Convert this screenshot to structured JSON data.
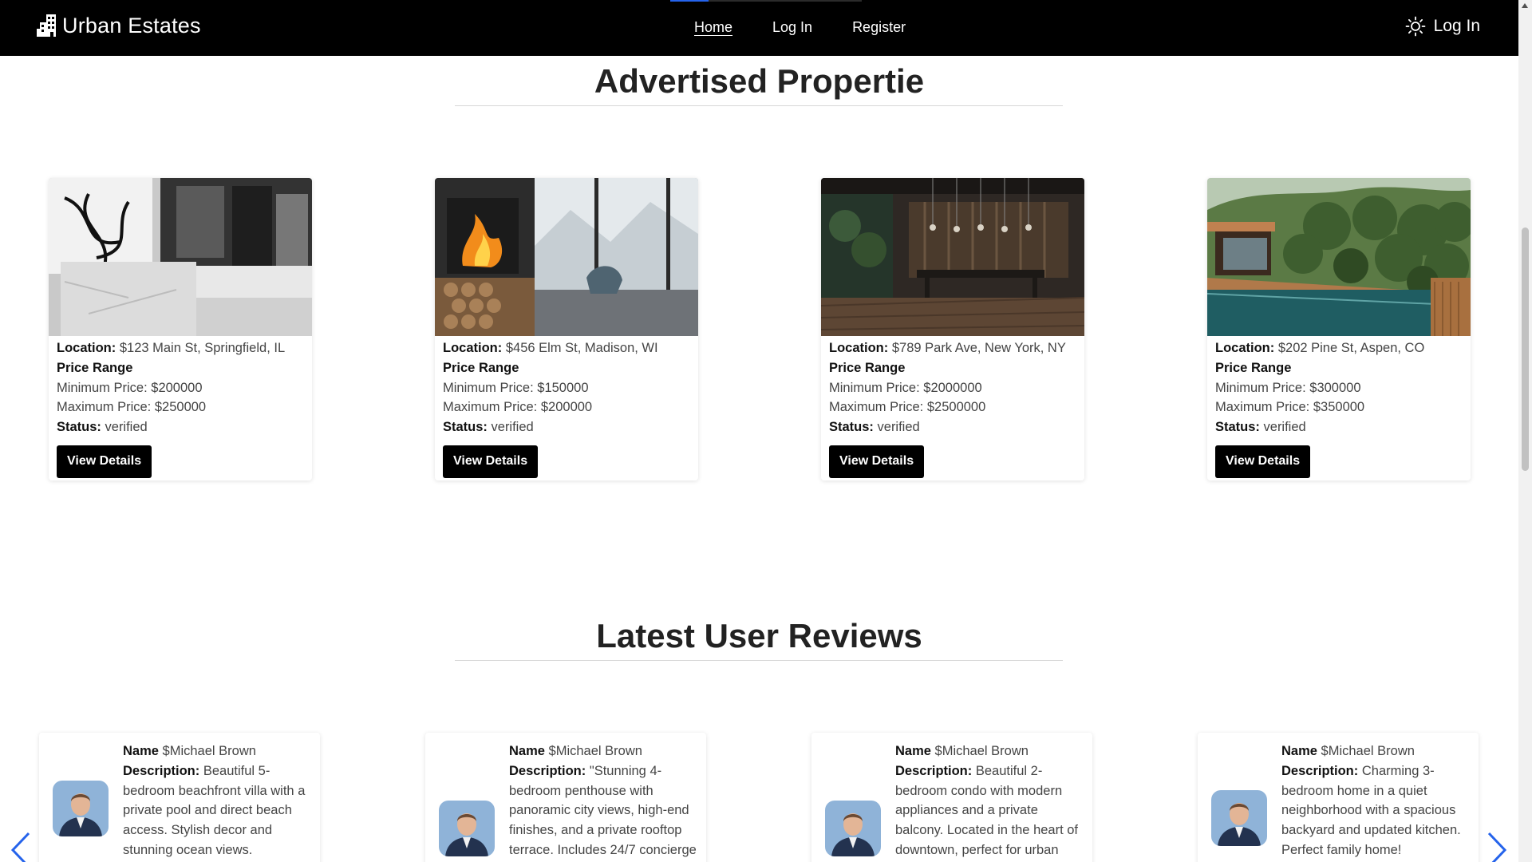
{
  "navbar": {
    "brand": "Urban Estates",
    "links": [
      {
        "label": "Home",
        "active": true
      },
      {
        "label": "Log In",
        "active": false
      },
      {
        "label": "Register",
        "active": false
      }
    ],
    "right_login": "Log In"
  },
  "advertised": {
    "title": "Advertised Propertie",
    "location_label": "Location:",
    "price_range_label": "Price Range",
    "min_price_label": "Minimum Price:",
    "max_price_label": "Maximum Price:",
    "status_label": "Status:",
    "button_label": "View Details",
    "properties": [
      {
        "location": "$123 Main St, Springfield, IL",
        "min_price": "$200000",
        "max_price": "$250000",
        "status": "verified"
      },
      {
        "location": "$456 Elm St, Madison, WI",
        "min_price": "$150000",
        "max_price": "$200000",
        "status": "verified"
      },
      {
        "location": "$789 Park Ave, New York, NY",
        "min_price": "$2000000",
        "max_price": "$2500000",
        "status": "verified"
      },
      {
        "location": "$202 Pine St, Aspen, CO",
        "min_price": "$300000",
        "max_price": "$350000",
        "status": "verified"
      }
    ]
  },
  "reviews": {
    "title": "Latest User Reviews",
    "name_label": "Name",
    "description_label": "Description:",
    "items": [
      {
        "name": "$Michael Brown",
        "description": "Beautiful 5-bedroom beachfront villa with a private pool and direct beach access. Stylish decor and stunning ocean views."
      },
      {
        "name": "$Michael Brown",
        "description": "\"Stunning 4-bedroom penthouse with panoramic city views, high-end finishes, and a private rooftop terrace. Includes 24/7 concierge"
      },
      {
        "name": "$Michael Brown",
        "description": "Beautiful 2-bedroom condo with modern appliances and a private balcony. Located in the heart of downtown, perfect for urban"
      },
      {
        "name": "$Michael Brown",
        "description": "Charming 3-bedroom home in a quiet neighborhood with a spacious backyard and updated kitchen. Perfect family home!"
      }
    ]
  },
  "colors": {
    "navbar": "#000000",
    "button": "#000000",
    "arrow": "#2563eb",
    "active_indicator": "#2563eb"
  }
}
